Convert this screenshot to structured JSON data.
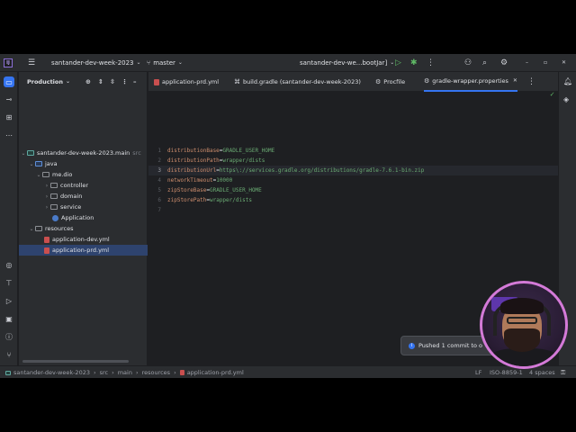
{
  "topbar": {
    "project_name": "santander-dev-week-2023",
    "branch": "master",
    "run_config": "santander-dev-we...bootJar]"
  },
  "project_panel": {
    "title": "Production",
    "tree": [
      {
        "label": "santander-dev-week-2023.main",
        "suffix": "src"
      },
      {
        "label": "java"
      },
      {
        "label": "me.dio"
      },
      {
        "label": "controller"
      },
      {
        "label": "domain"
      },
      {
        "label": "service"
      },
      {
        "label": "Application"
      },
      {
        "label": "resources"
      },
      {
        "label": "application-dev.yml"
      },
      {
        "label": "application-prd.yml"
      }
    ]
  },
  "tabs": [
    {
      "label": "application-prd.yml"
    },
    {
      "label": "build.gradle (santander-dev-week-2023)"
    },
    {
      "label": "Procfile"
    },
    {
      "label": "gradle-wrapper.properties"
    }
  ],
  "editor": {
    "lines": [
      {
        "num": "1",
        "key": "distributionBase",
        "value": "GRADLE_USER_HOME"
      },
      {
        "num": "2",
        "key": "distributionPath",
        "value": "wrapper/dists"
      },
      {
        "num": "3",
        "key": "distributionUrl",
        "value": "https\\://services.gradle.org/distributions/gradle-7.6.1-bin.zip"
      },
      {
        "num": "4",
        "key": "networkTimeout",
        "value": "10000"
      },
      {
        "num": "5",
        "key": "zipStoreBase",
        "value": "GRADLE_USER_HOME"
      },
      {
        "num": "6",
        "key": "zipStorePath",
        "value": "wrapper/dists"
      },
      {
        "num": "7",
        "key": "",
        "value": ""
      }
    ]
  },
  "statusbar": {
    "breadcrumb": [
      "santander-dev-week-2023",
      "src",
      "main",
      "resources",
      "application-prd.yml"
    ],
    "line_sep": "LF",
    "encoding": "ISO-8859-1",
    "indent": "4 spaces"
  },
  "notification": {
    "text": "Pushed 1 commit to o"
  },
  "colors": {
    "accent": "#3574f0",
    "key": "#cf8e6d",
    "value": "#6aab73"
  }
}
